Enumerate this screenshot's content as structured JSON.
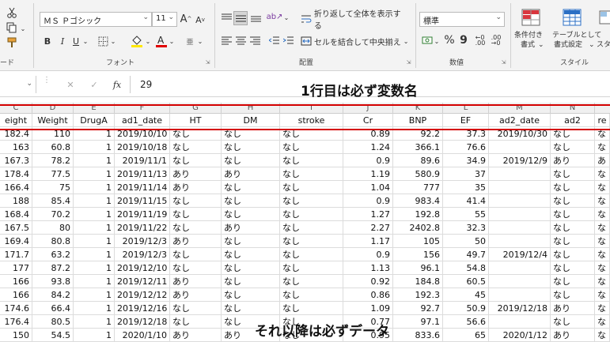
{
  "ribbon": {
    "cut_icon": "scissors-icon",
    "copy_icon": "copy-icon",
    "paint_icon": "format-painter-icon",
    "clipboard_label": "ード",
    "font_name": "ＭＳ Ｐゴシック",
    "font_size": "11",
    "bold": "B",
    "italic": "I",
    "underline": "U",
    "grow_font": "A",
    "shrink_font": "A",
    "font_group_label": "フォント",
    "wrap_text": "折り返して全体を表示する",
    "merge_center": "セルを結合して中央揃え",
    "alignment_group_label": "配置",
    "number_format": "標準",
    "percent": "%",
    "comma": "9",
    "number_group_label": "数値",
    "cond_format": [
      "条件付き",
      "書式"
    ],
    "table_format": [
      "テーブルとして",
      "書式設定"
    ],
    "cell_styles": [
      "スタ"
    ],
    "styles_group_label": "スタイル",
    "fill_color": "#ffe800",
    "font_color": "#e00000"
  },
  "formula_bar": {
    "cancel": "✕",
    "confirm": "✓",
    "fx": "fx",
    "value": "29"
  },
  "annotations": {
    "top": "1行目は必ず変数名",
    "bottom": "それ以降は必ずデータ"
  },
  "columns": [
    "C",
    "D",
    "E",
    "F",
    "G",
    "H",
    "I",
    "J",
    "K",
    "L",
    "M",
    "N"
  ],
  "header_row": [
    "eight",
    "Weight",
    "DrugA",
    "ad1_date",
    "HT",
    "DM",
    "stroke",
    "Cr",
    "BNP",
    "EF",
    "ad2_date",
    "ad2",
    "re"
  ],
  "rows": [
    [
      "182.4",
      "110",
      "1",
      "2019/10/10",
      "なし",
      "なし",
      "なし",
      "0.89",
      "92.2",
      "37.3",
      "2019/10/30",
      "なし",
      "な"
    ],
    [
      "163",
      "60.8",
      "1",
      "2019/10/18",
      "なし",
      "なし",
      "なし",
      "1.24",
      "366.1",
      "76.6",
      "",
      "なし",
      "な"
    ],
    [
      "167.3",
      "78.2",
      "1",
      "2019/11/1",
      "なし",
      "なし",
      "なし",
      "0.9",
      "89.6",
      "34.9",
      "2019/12/9",
      "あり",
      "あ"
    ],
    [
      "178.4",
      "77.5",
      "1",
      "2019/11/13",
      "あり",
      "あり",
      "なし",
      "1.19",
      "580.9",
      "37",
      "",
      "なし",
      "な"
    ],
    [
      "166.4",
      "75",
      "1",
      "2019/11/14",
      "あり",
      "なし",
      "なし",
      "1.04",
      "777",
      "35",
      "",
      "なし",
      "な"
    ],
    [
      "188",
      "85.4",
      "1",
      "2019/11/15",
      "なし",
      "なし",
      "なし",
      "0.9",
      "983.4",
      "41.4",
      "",
      "なし",
      "な"
    ],
    [
      "168.4",
      "70.2",
      "1",
      "2019/11/19",
      "なし",
      "なし",
      "なし",
      "1.27",
      "192.8",
      "55",
      "",
      "なし",
      "な"
    ],
    [
      "167.5",
      "80",
      "1",
      "2019/11/22",
      "なし",
      "あり",
      "なし",
      "2.27",
      "2402.8",
      "32.3",
      "",
      "なし",
      "な"
    ],
    [
      "169.4",
      "80.8",
      "1",
      "2019/12/3",
      "あり",
      "なし",
      "なし",
      "1.17",
      "105",
      "50",
      "",
      "なし",
      "な"
    ],
    [
      "171.7",
      "63.2",
      "1",
      "2019/12/3",
      "なし",
      "なし",
      "なし",
      "0.9",
      "156",
      "49.7",
      "2019/12/4",
      "なし",
      "な"
    ],
    [
      "177",
      "87.2",
      "1",
      "2019/12/10",
      "なし",
      "なし",
      "なし",
      "1.13",
      "96.1",
      "54.8",
      "",
      "なし",
      "な"
    ],
    [
      "166",
      "93.8",
      "1",
      "2019/12/11",
      "あり",
      "なし",
      "なし",
      "0.92",
      "184.8",
      "60.5",
      "",
      "なし",
      "な"
    ],
    [
      "166",
      "84.2",
      "1",
      "2019/12/12",
      "あり",
      "なし",
      "なし",
      "0.86",
      "192.3",
      "45",
      "",
      "なし",
      "な"
    ],
    [
      "174.6",
      "66.4",
      "1",
      "2019/12/16",
      "なし",
      "なし",
      "なし",
      "1.09",
      "92.7",
      "50.9",
      "2019/12/18",
      "あり",
      "な"
    ],
    [
      "176.4",
      "80.5",
      "1",
      "2019/12/18",
      "なし",
      "なし",
      "なし",
      "0.77",
      "97.1",
      "56.6",
      "",
      "なし",
      "な"
    ],
    [
      "150",
      "54.5",
      "1",
      "2020/1/10",
      "あり",
      "あり",
      "なし",
      "0.95",
      "833.6",
      "65",
      "2020/1/12",
      "あり",
      "な"
    ]
  ]
}
